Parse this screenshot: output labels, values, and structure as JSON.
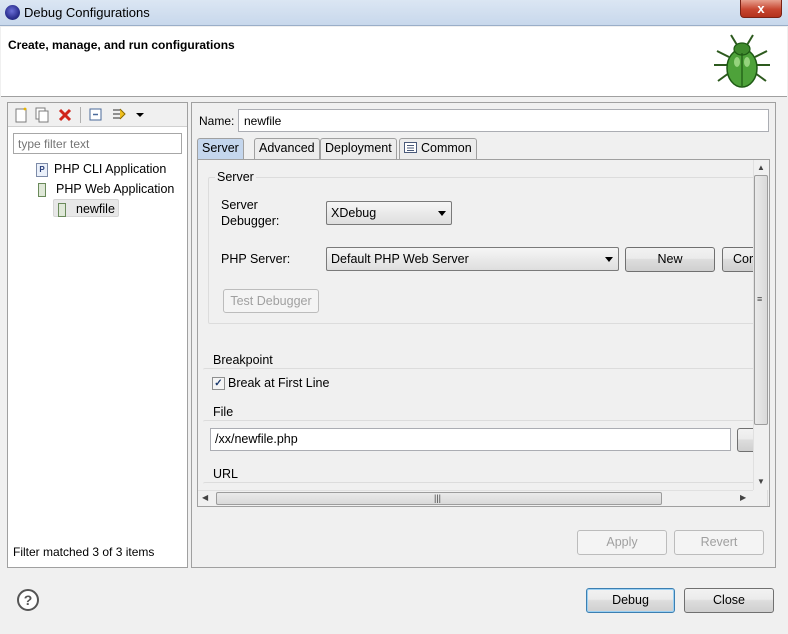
{
  "window": {
    "title": "Debug Configurations",
    "close_label": "x"
  },
  "header": {
    "title": "Create, manage, and run configurations"
  },
  "left": {
    "filter_placeholder": "type filter text",
    "tree": [
      {
        "label": "PHP CLI Application",
        "icon": "php-cli-icon"
      },
      {
        "label": "PHP Web Application",
        "icon": "php-web-icon"
      },
      {
        "label": "newfile",
        "icon": "php-web-config-icon"
      }
    ],
    "status": "Filter matched 3 of 3 items",
    "toolbar_icons": [
      "new-config-icon",
      "duplicate-icon",
      "delete-icon",
      "collapse-all-icon",
      "filter-icon",
      "dropdown-icon"
    ]
  },
  "config": {
    "name_label": "Name:",
    "name_value": "newfile",
    "tabs": [
      {
        "label": "Server",
        "active": true
      },
      {
        "label": "Advanced",
        "active": false
      },
      {
        "label": "Deployment",
        "active": false
      },
      {
        "label": "Common",
        "active": false
      }
    ],
    "server_group": {
      "title": "Server",
      "debugger_label_line1": "Server",
      "debugger_label_line2": "Debugger:",
      "debugger_value": "XDebug",
      "php_server_label": "PHP Server:",
      "php_server_value": "Default PHP Web Server",
      "new_button": "New",
      "configure_button_partial": "Cor",
      "test_button": "Test Debugger"
    },
    "breakpoint_group": {
      "title": "Breakpoint",
      "checkbox_label": "Break at First Line",
      "checked": true
    },
    "file_group": {
      "title": "File",
      "value": "/xx/newfile.php"
    },
    "url_group": {
      "title": "URL"
    },
    "apply_button": "Apply",
    "revert_button": "Revert"
  },
  "footer": {
    "help_label": "?",
    "debug_button": "Debug",
    "close_button": "Close"
  }
}
